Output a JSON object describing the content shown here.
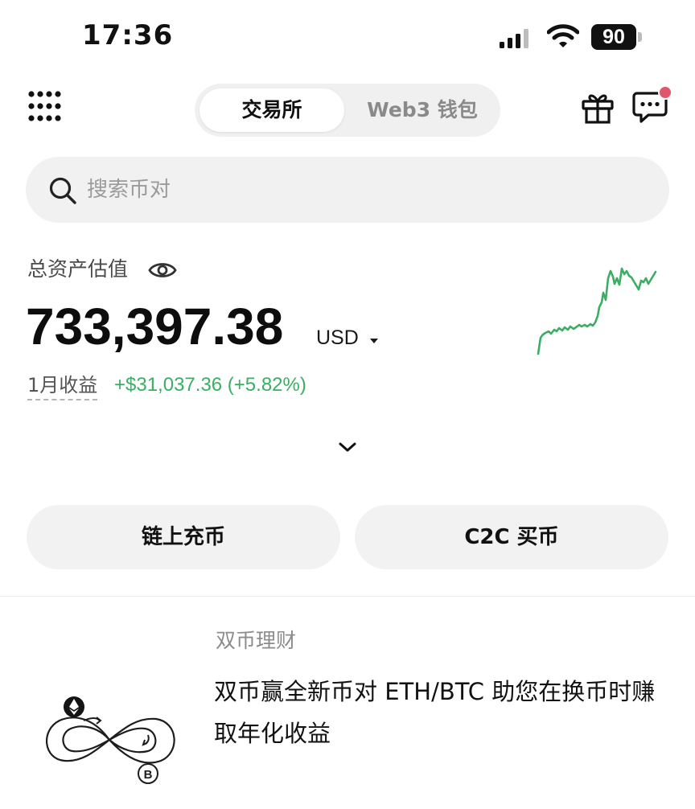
{
  "status_bar": {
    "time": "17:36",
    "battery": "90"
  },
  "header": {
    "tabs": [
      {
        "label": "交易所",
        "active": true
      },
      {
        "label": "Web3 钱包",
        "active": false
      }
    ],
    "icons": [
      "menu-grid-icon",
      "gift-icon",
      "chat-icon"
    ],
    "has_notification": true
  },
  "search": {
    "placeholder": "搜索币对"
  },
  "assets": {
    "label": "总资产估值",
    "value": "733,397.38",
    "currency": "USD",
    "pnl_label": "1月收益",
    "pnl_value": "+$31,037.36 (+5.82%)"
  },
  "actions": {
    "deposit_label": "链上充币",
    "c2c_label": "C2C 买币"
  },
  "promo": {
    "tag": "双币理财",
    "title": "双币赢全新币对 ETH/BTC 助您在换币时赚取年化收益"
  },
  "colors": {
    "positive": "#3cae63",
    "notification": "#e0566a",
    "pill_bg": "#f1f1f1"
  }
}
